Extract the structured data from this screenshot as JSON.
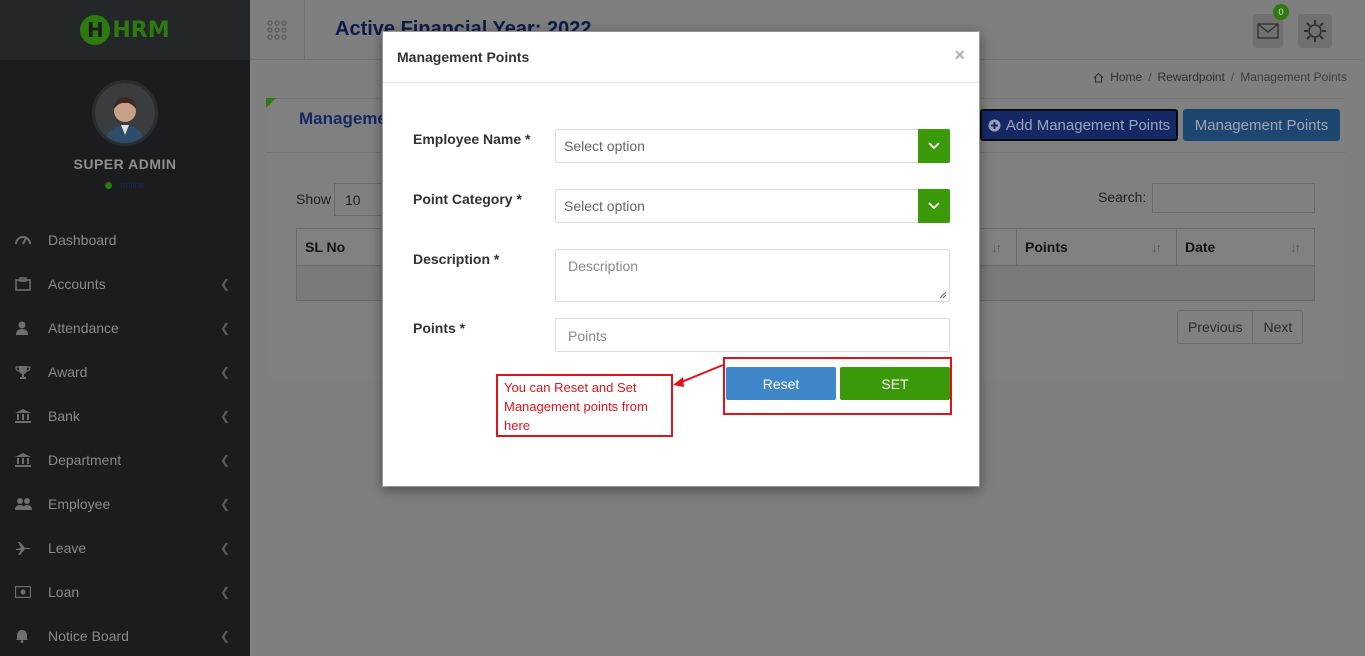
{
  "app": {
    "logo_text": "HRM",
    "logo_letter": "H"
  },
  "sidebar": {
    "user_name": "SUPER ADMIN",
    "status": "online",
    "items": [
      {
        "label": "Dashboard",
        "icon": "dashboard-icon",
        "has_chevron": false
      },
      {
        "label": "Accounts",
        "icon": "briefcase-icon",
        "has_chevron": true
      },
      {
        "label": "Attendance",
        "icon": "user-icon",
        "has_chevron": true
      },
      {
        "label": "Award",
        "icon": "trophy-icon",
        "has_chevron": true
      },
      {
        "label": "Bank",
        "icon": "bank-icon",
        "has_chevron": true
      },
      {
        "label": "Department",
        "icon": "bank-icon",
        "has_chevron": true
      },
      {
        "label": "Employee",
        "icon": "users-icon",
        "has_chevron": true
      },
      {
        "label": "Leave",
        "icon": "plane-icon",
        "has_chevron": true
      },
      {
        "label": "Loan",
        "icon": "money-icon",
        "has_chevron": true
      },
      {
        "label": "Notice Board",
        "icon": "bell-icon",
        "has_chevron": true
      }
    ]
  },
  "header": {
    "financial_year": "Active Financial Year: 2022",
    "mail_badge": "0"
  },
  "breadcrumb": {
    "home": "Home",
    "parent": "Rewardpoint",
    "current": "Management Points"
  },
  "panel": {
    "title": "Management Points",
    "add_button": "Add Management Points",
    "list_button": "Management Points",
    "show_label": "Show",
    "show_value": "10",
    "search_label": "Search:",
    "columns": [
      "SL No",
      "Points",
      "Date"
    ],
    "prev_label": "Previous",
    "next_label": "Next"
  },
  "modal": {
    "title": "Management Points",
    "close": "×",
    "fields": {
      "employee_label": "Employee Name *",
      "employee_placeholder": "Select option",
      "category_label": "Point Category *",
      "category_placeholder": "Select option",
      "description_label": "Description *",
      "description_placeholder": "Description",
      "points_label": "Points *",
      "points_placeholder": "Points"
    },
    "reset_label": "Reset",
    "set_label": "SET",
    "annotation": "You can Reset and Set Management points from here"
  },
  "colors": {
    "accent_green": "#3a9a0a",
    "primary_blue": "#3f87c8",
    "annotation_red": "#e0131a",
    "sidebar_bg": "#1a1c1e"
  }
}
